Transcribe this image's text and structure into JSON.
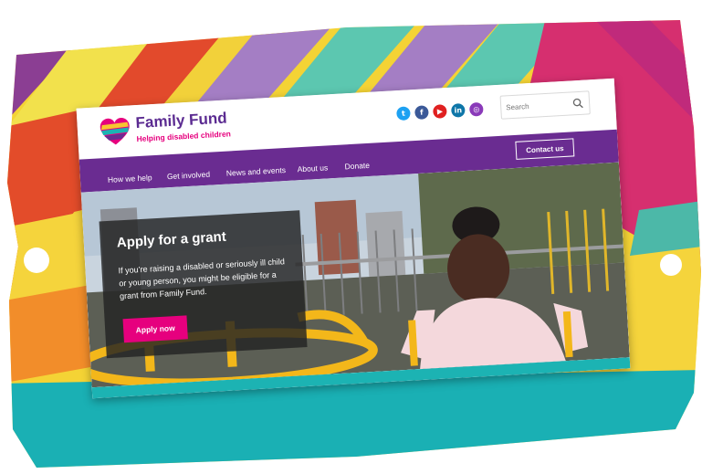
{
  "brand": {
    "name": "Family Fund",
    "tagline": "Helping disabled children"
  },
  "social": [
    {
      "icon": "twitter-icon",
      "glyph": "t",
      "color": "#1da1f2"
    },
    {
      "icon": "facebook-icon",
      "glyph": "f",
      "color": "#3b5998"
    },
    {
      "icon": "youtube-icon",
      "glyph": "▶",
      "color": "#e02020"
    },
    {
      "icon": "linkedin-icon",
      "glyph": "in",
      "color": "#0e76a8"
    },
    {
      "icon": "instagram-icon",
      "glyph": "◎",
      "color": "#8a3ab9"
    }
  ],
  "search": {
    "placeholder": "Search"
  },
  "nav": {
    "items": [
      "How we help",
      "Get involved",
      "News and events",
      "About us",
      "Donate"
    ],
    "contact_label": "Contact us"
  },
  "hero": {
    "title": "Apply for a grant",
    "body": "If you’re raising a disabled or seriously ill child or young person, you might be eligible for a grant from Family Fund.",
    "cta_label": "Apply now"
  },
  "colors": {
    "brand_purple": "#6a2c91",
    "brand_pink": "#e6007e",
    "teal": "#1cb3b3"
  }
}
